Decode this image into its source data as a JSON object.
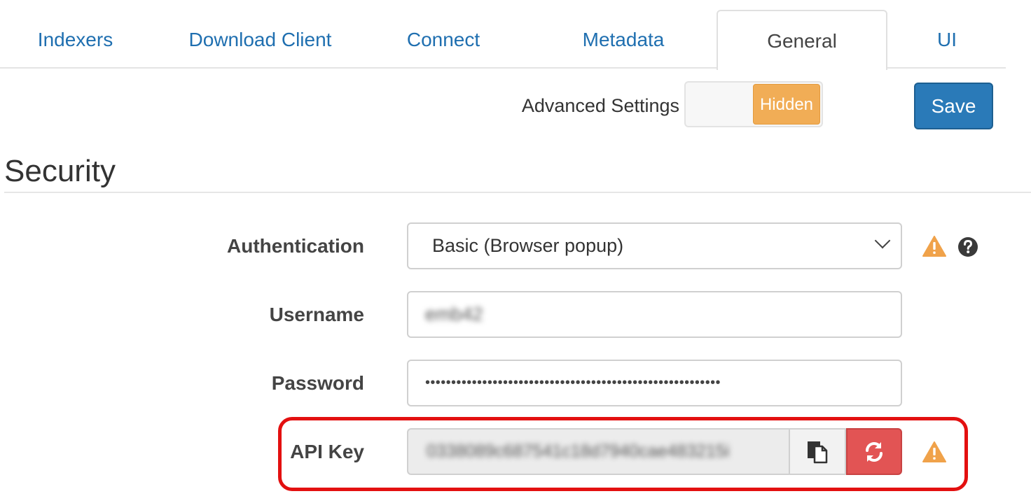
{
  "tabs": [
    {
      "label": "Indexers"
    },
    {
      "label": "Download Client"
    },
    {
      "label": "Connect"
    },
    {
      "label": "Metadata"
    },
    {
      "label": "General",
      "active": true
    },
    {
      "label": "UI"
    }
  ],
  "toolbar": {
    "advanced_settings_label": "Advanced Settings",
    "advanced_settings_state": "Hidden",
    "save_label": "Save"
  },
  "security": {
    "title": "Security",
    "authentication": {
      "label": "Authentication",
      "value": "Basic (Browser popup)"
    },
    "username": {
      "label": "Username",
      "value": "emb42"
    },
    "password": {
      "label": "Password",
      "value": "•••••••••••••••••••••••••••••••••••••••••••••••••••••••••"
    },
    "api_key": {
      "label": "API Key",
      "value": "0338089c687541c18d7940cae483215i"
    }
  },
  "colors": {
    "accent": "#2a7ab8",
    "tab_text": "#1f6fb0",
    "toggle_hidden": "#f1ad56",
    "danger": "#e25454",
    "warning": "#f0a24a",
    "highlight": "#e31010"
  },
  "icons": [
    "warning-icon",
    "help-icon",
    "copy-icon",
    "refresh-icon",
    "chevron-down-icon"
  ]
}
